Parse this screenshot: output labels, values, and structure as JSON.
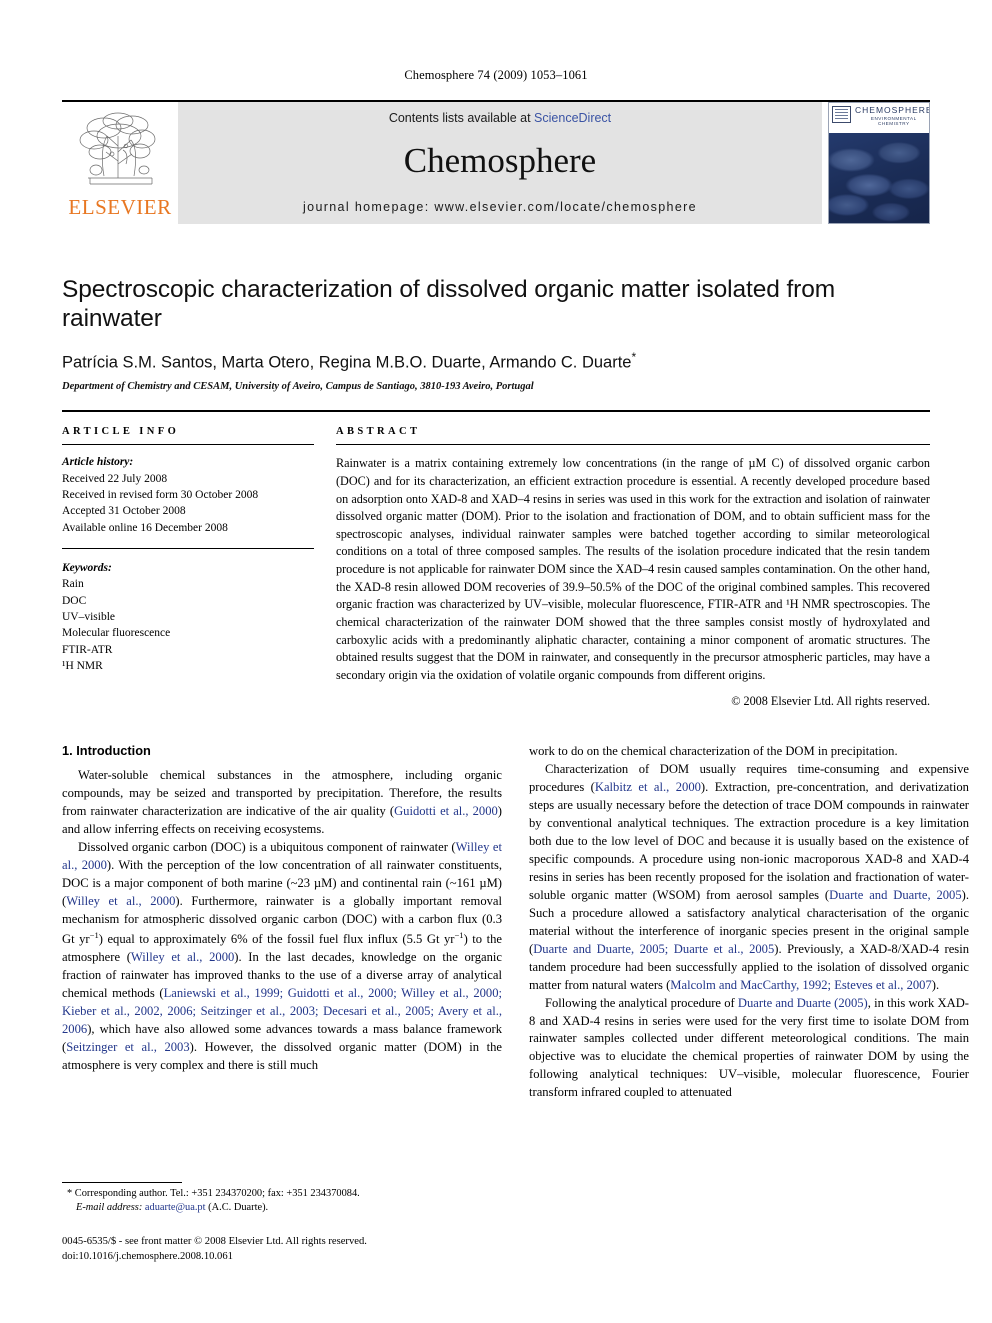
{
  "running_head": "Chemosphere 74 (2009) 1053–1061",
  "masthead": {
    "publisher_logo_name": "elsevier-logo",
    "publisher_wordmark": "ELSEVIER",
    "contents_prefix": "Contents lists available at ",
    "contents_link": "ScienceDirect",
    "journal_name": "Chemosphere",
    "homepage": "journal homepage: www.elsevier.com/locate/chemosphere",
    "cover": {
      "title": "CHEMOSPHERE",
      "subtitle": "ENVIRONMENTAL CHEMISTRY"
    },
    "link_color": "#3a53a4",
    "banner_bg": "#e3e3e3",
    "wordmark_color": "#e87722"
  },
  "article": {
    "title": "Spectroscopic characterization of dissolved organic matter isolated from rainwater",
    "authors": "Patrícia S.M. Santos, Marta Otero, Regina M.B.O. Duarte, Armando C. Duarte",
    "corresponding_marker": "*",
    "affiliation": "Department of Chemistry and CESAM, University of Aveiro, Campus de Santiago, 3810-193 Aveiro, Portugal"
  },
  "info": {
    "heading": "ARTICLE INFO",
    "history_label": "Article history:",
    "history": [
      "Received 22 July 2008",
      "Received in revised form 30 October 2008",
      "Accepted 31 October 2008",
      "Available online 16 December 2008"
    ],
    "keywords_label": "Keywords:",
    "keywords": [
      "Rain",
      "DOC",
      "UV–visible",
      "Molecular fluorescence",
      "FTIR-ATR",
      "¹H NMR"
    ]
  },
  "abstract": {
    "heading": "ABSTRACT",
    "text": "Rainwater is a matrix containing extremely low concentrations (in the range of µM C) of dissolved organic carbon (DOC) and for its characterization, an efficient extraction procedure is essential. A recently developed procedure based on adsorption onto XAD-8 and XAD–4 resins in series was used in this work for the extraction and isolation of rainwater dissolved organic matter (DOM). Prior to the isolation and fractionation of DOM, and to obtain sufficient mass for the spectroscopic analyses, individual rainwater samples were batched together according to similar meteorological conditions on a total of three composed samples. The results of the isolation procedure indicated that the resin tandem procedure is not applicable for rainwater DOM since the XAD–4 resin caused samples contamination. On the other hand, the XAD-8 resin allowed DOM recoveries of 39.9–50.5% of the DOC of the original combined samples. This recovered organic fraction was characterized by UV–visible, molecular fluorescence, FTIR-ATR and ¹H NMR spectroscopies. The chemical characterization of the rainwater DOM showed that the three samples consist mostly of hydroxylated and carboxylic acids with a predominantly aliphatic character, containing a minor component of aromatic structures. The obtained results suggest that the DOM in rainwater, and consequently in the precursor atmospheric particles, may have a secondary origin via the oxidation of volatile organic compounds from different origins.",
    "copyright": "© 2008 Elsevier Ltd. All rights reserved."
  },
  "introduction": {
    "heading": "1. Introduction",
    "left_paragraphs": [
      {
        "segments": [
          {
            "t": "Water-soluble chemical substances in the atmosphere, including organic compounds, may be seized and transported by precipitation. Therefore, the results from rainwater characterization are indicative of the air quality (",
            "cite": false
          },
          {
            "t": "Guidotti et al., 2000",
            "cite": true
          },
          {
            "t": ") and allow inferring effects on receiving ecosystems.",
            "cite": false
          }
        ]
      },
      {
        "segments": [
          {
            "t": "Dissolved organic carbon (DOC) is a ubiquitous component of rainwater (",
            "cite": false
          },
          {
            "t": "Willey et al., 2000",
            "cite": true
          },
          {
            "t": "). With the perception of the low concentration of all rainwater constituents, DOC is a major component of both marine (~23 µM) and continental rain (~161 µM) (",
            "cite": false
          },
          {
            "t": "Willey et al., 2000",
            "cite": true
          },
          {
            "t": "). Furthermore, rainwater is a globally important removal mechanism for atmospheric dissolved organic carbon (DOC) with a carbon flux (0.3 Gt yr",
            "cite": false
          },
          {
            "t": "−1",
            "sup": true
          },
          {
            "t": ") equal to approximately 6% of the fossil fuel flux influx (5.5 Gt yr",
            "cite": false
          },
          {
            "t": "−1",
            "sup": true
          },
          {
            "t": ") to the atmosphere (",
            "cite": false
          },
          {
            "t": "Willey et al., 2000",
            "cite": true
          },
          {
            "t": "). In the last decades, knowledge on the organic fraction of rainwater has improved thanks to the use of a diverse array of analytical chemical methods (",
            "cite": false
          },
          {
            "t": "Laniewski et al., 1999; Guidotti et al., 2000; Willey et al., 2000; Kieber et al., 2002, 2006; Seitzinger et al., 2003; Decesari et al., 2005; Avery et al., 2006",
            "cite": true
          },
          {
            "t": "), which have also allowed some advances towards a mass balance framework (",
            "cite": false
          },
          {
            "t": "Seitzinger et al., 2003",
            "cite": true
          },
          {
            "t": "). However, the dissolved organic matter (DOM) in the atmosphere is very complex and there is still much",
            "cite": false
          }
        ]
      }
    ],
    "right_paragraphs": [
      {
        "noindent": true,
        "segments": [
          {
            "t": "work to do on the chemical characterization of the DOM in precipitation.",
            "cite": false
          }
        ]
      },
      {
        "segments": [
          {
            "t": "Characterization of DOM usually requires time-consuming and expensive procedures (",
            "cite": false
          },
          {
            "t": "Kalbitz et al., 2000",
            "cite": true
          },
          {
            "t": "). Extraction, pre-concentration, and derivatization steps are usually necessary before the detection of trace DOM compounds in rainwater by conventional analytical techniques. The extraction procedure is a key limitation both due to the low level of DOC and because it is usually based on the existence of specific compounds. A procedure using non-ionic macroporous XAD-8 and XAD-4 resins in series has been recently proposed for the isolation and fractionation of water-soluble organic matter (WSOM) from aerosol samples (",
            "cite": false
          },
          {
            "t": "Duarte and Duarte, 2005",
            "cite": true
          },
          {
            "t": "). Such a procedure allowed a satisfactory analytical characterisation of the organic material without the interference of inorganic species present in the original sample (",
            "cite": false
          },
          {
            "t": "Duarte and Duarte, 2005; Duarte et al., 2005",
            "cite": true
          },
          {
            "t": "). Previously, a XAD-8/XAD-4 resin tandem procedure had been successfully applied to the isolation of dissolved organic matter from natural waters (",
            "cite": false
          },
          {
            "t": "Malcolm and MacCarthy, 1992; Esteves et al., 2007",
            "cite": true
          },
          {
            "t": ").",
            "cite": false
          }
        ]
      },
      {
        "segments": [
          {
            "t": "Following the analytical procedure of ",
            "cite": false
          },
          {
            "t": "Duarte and Duarte (2005)",
            "cite": true
          },
          {
            "t": ", in this work XAD-8 and XAD-4 resins in series were used for the very first time to isolate DOM from rainwater samples collected under different meteorological conditions. The main objective was to elucidate the chemical properties of rainwater DOM by using the following analytical techniques: UV–visible, molecular fluorescence, Fourier transform infrared coupled to attenuated",
            "cite": false
          }
        ]
      }
    ]
  },
  "footnotes": {
    "corresponding": "* Corresponding author. Tel.: +351 234370200; fax: +351 234370084.",
    "email_label": "E-mail address:",
    "email": "aduarte@ua.pt",
    "email_suffix": " (A.C. Duarte)."
  },
  "imprint": {
    "line1": "0045-6535/$ - see front matter © 2008 Elsevier Ltd. All rights reserved.",
    "line2": "doi:10.1016/j.chemosphere.2008.10.061"
  },
  "colors": {
    "citation_blue": "#22368a",
    "link_blue": "#3a53a4",
    "elsevier_orange": "#e87722"
  }
}
